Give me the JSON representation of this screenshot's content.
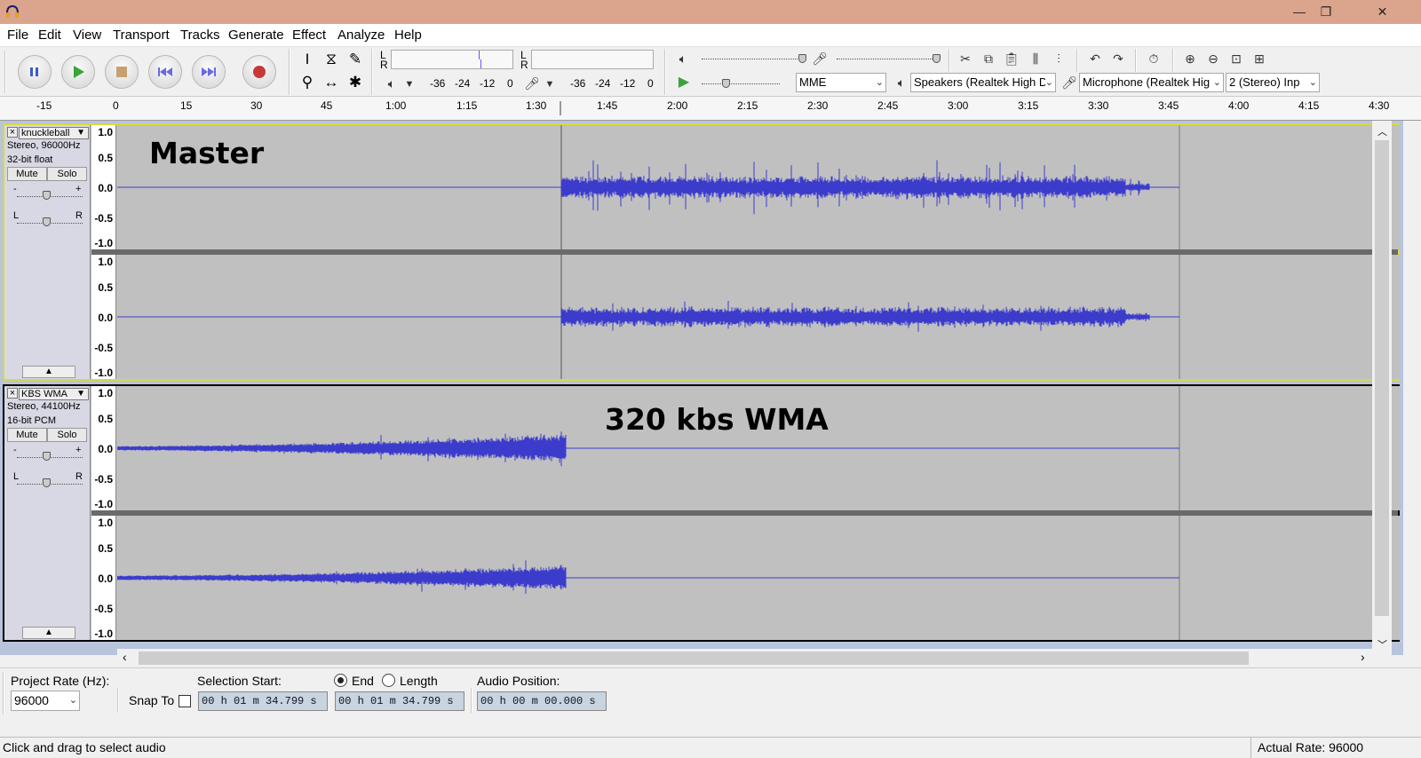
{
  "window": {
    "minimize": "—",
    "maximize": "❐",
    "close": "✕"
  },
  "menu": [
    "File",
    "Edit",
    "View",
    "Transport",
    "Tracks",
    "Generate",
    "Effect",
    "Analyze",
    "Help"
  ],
  "meters": {
    "record_scale": [
      "-36",
      "-24",
      "-12",
      "0"
    ],
    "play_scale": [
      "-36",
      "-24",
      "-12",
      "0"
    ],
    "l": "L",
    "r": "R"
  },
  "device": {
    "host": "MME",
    "output": "Speakers (Realtek High D",
    "input": "Microphone (Realtek Hig",
    "channels": "2 (Stereo) Inp"
  },
  "ruler": [
    "-15",
    "0",
    "15",
    "30",
    "45",
    "1:00",
    "1:15",
    "1:30",
    "1:45",
    "2:00",
    "2:15",
    "2:30",
    "2:45",
    "3:00",
    "3:15",
    "3:30",
    "3:45",
    "4:00",
    "4:15",
    "4:30"
  ],
  "tracks": [
    {
      "name": "knuckleball",
      "line1": "Stereo, 96000Hz",
      "line2": "32-bit float",
      "mute": "Mute",
      "solo": "Solo",
      "overlay": "Master"
    },
    {
      "name": "KBS WMA",
      "line1": "Stereo, 44100Hz",
      "line2": "16-bit PCM",
      "mute": "Mute",
      "solo": "Solo",
      "overlay": "320 kbs WMA"
    }
  ],
  "scale": [
    "1.0",
    "0.5",
    "0.0",
    "-0.5",
    "-1.0"
  ],
  "gain": {
    "minus": "-",
    "plus": "+"
  },
  "pan": {
    "l": "L",
    "r": "R"
  },
  "selection": {
    "project_rate_label": "Project Rate (Hz):",
    "project_rate": "96000",
    "snap_label": "Snap To",
    "start_label": "Selection Start:",
    "end_label": "End",
    "length_label": "Length",
    "position_label": "Audio Position:",
    "start": "00 h 01 m 34.799 s",
    "end": "00 h 01 m 34.799 s",
    "position": "00 h 00 m 00.000 s"
  },
  "status": {
    "left": "Click and drag to select audio",
    "right": "Actual Rate: 96000"
  },
  "colors": {
    "waveform": "#3c3ccc",
    "track_bg": "#c0c0c0",
    "titlebar": "#dba48c"
  }
}
